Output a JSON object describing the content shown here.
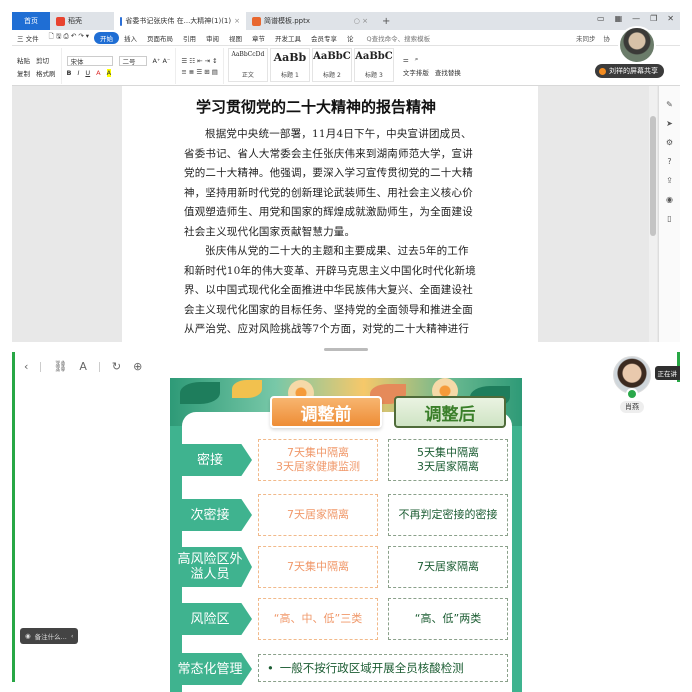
{
  "top_window": {
    "tabs": [
      {
        "label": "首页"
      },
      {
        "label": "稻壳"
      },
      {
        "label": "省委书记张庆伟 在...大精神(1)(1)"
      },
      {
        "label": "简谱模板.pptx"
      }
    ],
    "menu": {
      "file": "三 文件",
      "items": [
        "开始",
        "插入",
        "页面布局",
        "引用",
        "审阅",
        "视图",
        "章节",
        "开发工具",
        "会员专享",
        "论"
      ],
      "search": "Q查找命令、搜索模板",
      "right": [
        "未同步",
        "协"
      ]
    },
    "ribbon": {
      "paste": "粘贴",
      "cut": "剪切",
      "copy": "复制",
      "format_painter": "格式刷",
      "font": "宋体",
      "font_size": "二号",
      "styles": [
        {
          "sample": "AaBbCcDd",
          "name": "正文"
        },
        {
          "sample": "AaBb",
          "name": "标题 1"
        },
        {
          "sample": "AaBbC",
          "name": "标题 2"
        },
        {
          "sample": "AaBbC",
          "name": "标题 3"
        }
      ],
      "text_layout": "文字排版",
      "find_replace": "查找替换"
    },
    "share": {
      "label": "刘祥的屏幕共享"
    },
    "document": {
      "title": "学习贯彻党的二十大精神的报告精神",
      "paragraphs": [
        "根据党中央统一部署，11月4日下午，中央宣讲团成员、省委书记、省人大常委会主任张庆伟来到湖南师范大学，宣讲党的二十大精神。他强调，要深入学习宣传贯彻党的二十大精神，坚持用新时代党的创新理论武装师生、用社会主义核心价值观塑造师生、用党和国家的辉煌成就激励师生，为全面建设社会主义现代化国家贡献智慧力量。",
        "张庆伟从党的二十大的主题和主要成果、过去5年的工作和新时代10年的伟大变革、开辟马克思主义中国化时代化新境界、以中国式现代化全面推进中华民族伟大复兴、全面建设社会主义现代化国家的目标任务、坚持党的全面领导和推进全面从严治党、应对风险挑战等7个方面，对党的二十大精神进行了系统解读。"
      ]
    }
  },
  "bottom_window": {
    "viewer": {
      "name": "肖燕"
    },
    "talking": "正在讲",
    "notes": "备注什么...",
    "slide": {
      "header_before": "调整前",
      "header_after": "调整后",
      "rows": [
        {
          "label": "密接",
          "before": [
            "7天集中隔离",
            "3天居家健康监测"
          ],
          "after": [
            "5天集中隔离",
            "3天居家隔离"
          ]
        },
        {
          "label": "次密接",
          "before": [
            "7天居家隔离"
          ],
          "after": [
            "不再判定密接的密接"
          ]
        },
        {
          "label": "高风险区外溢人员",
          "before": [
            "7天集中隔离"
          ],
          "after": [
            "7天居家隔离"
          ]
        },
        {
          "label": "风险区",
          "before": [
            "“高、中、低”三类"
          ],
          "after": [
            "“高、低”两类"
          ]
        }
      ],
      "last_row": {
        "label": "常态化管理",
        "text": "一般不按行政区域开展全员核酸检测"
      }
    }
  },
  "colors": {
    "accent_blue": "#1f6ed4",
    "slide_green": "#3fb38f",
    "before_orange": "#f0986a",
    "after_green": "#1c5d33"
  }
}
